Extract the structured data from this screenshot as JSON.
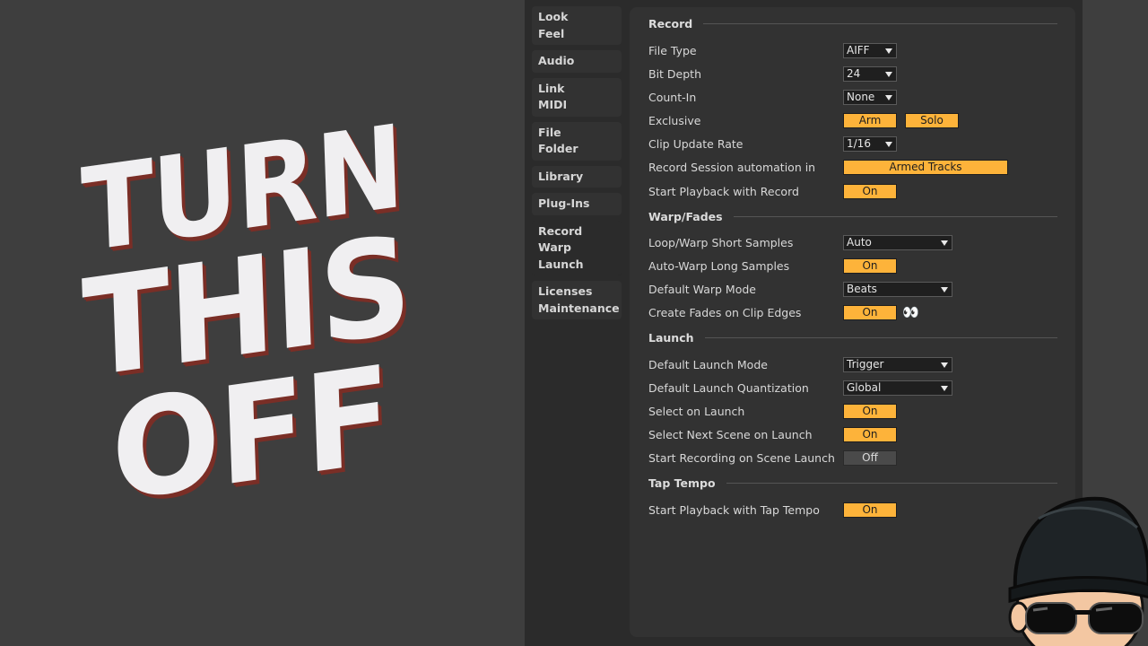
{
  "thumbnail": {
    "line1": "TURN",
    "line2": "THIS",
    "line3": "OFF"
  },
  "sidebar": {
    "items": [
      {
        "label": "Look\nFeel"
      },
      {
        "label": "Audio"
      },
      {
        "label": "Link\nMIDI"
      },
      {
        "label": "File\nFolder"
      },
      {
        "label": "Library"
      },
      {
        "label": "Plug-Ins"
      },
      {
        "label": "Record\nWarp\nLaunch"
      },
      {
        "label": "Licenses\nMaintenance"
      }
    ]
  },
  "record": {
    "heading": "Record",
    "file_type": {
      "label": "File Type",
      "value": "AIFF"
    },
    "bit_depth": {
      "label": "Bit Depth",
      "value": "24"
    },
    "count_in": {
      "label": "Count-In",
      "value": "None"
    },
    "exclusive": {
      "label": "Exclusive",
      "arm": "Arm",
      "solo": "Solo"
    },
    "clip_update_rate": {
      "label": "Clip Update Rate",
      "value": "1/16"
    },
    "session_automation": {
      "label": "Record Session automation in",
      "value": "Armed Tracks"
    },
    "start_playback": {
      "label": "Start Playback with Record",
      "value": "On"
    }
  },
  "warp": {
    "heading": "Warp/Fades",
    "loop_warp": {
      "label": "Loop/Warp Short Samples",
      "value": "Auto"
    },
    "auto_warp": {
      "label": "Auto-Warp Long Samples",
      "value": "On"
    },
    "default_warp_mode": {
      "label": "Default Warp Mode",
      "value": "Beats"
    },
    "create_fades": {
      "label": "Create Fades on Clip Edges",
      "value": "On",
      "emoji": "👀"
    }
  },
  "launch": {
    "heading": "Launch",
    "default_launch_mode": {
      "label": "Default Launch Mode",
      "value": "Trigger"
    },
    "default_launch_quant": {
      "label": "Default Launch Quantization",
      "value": "Global"
    },
    "select_on_launch": {
      "label": "Select on Launch",
      "value": "On"
    },
    "select_next_scene": {
      "label": "Select Next Scene on Launch",
      "value": "On"
    },
    "start_recording": {
      "label": "Start Recording on Scene Launch",
      "value": "Off"
    }
  },
  "tap_tempo": {
    "heading": "Tap Tempo",
    "start_playback": {
      "label": "Start Playback with Tap Tempo",
      "value": "On"
    }
  },
  "colors": {
    "accent": "#fdb33a",
    "panel": "#323232",
    "window": "#2b2b2b",
    "background": "#3e3e3e"
  }
}
